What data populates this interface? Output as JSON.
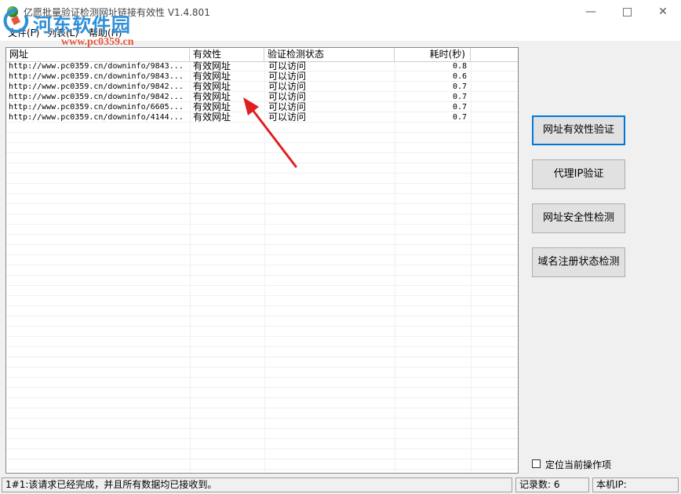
{
  "window": {
    "title": "亿愿批量验证检测网址链接有效性 V1.4.801",
    "minimize": "—",
    "close": "✕"
  },
  "watermark": {
    "title": "河东软件园",
    "url": "www.pc0359.cn"
  },
  "menu": [
    {
      "label": "文件(F)"
    },
    {
      "label": "列表(L)"
    },
    {
      "label": "帮助(H)"
    }
  ],
  "table": {
    "columns": [
      "网址",
      "有效性",
      "验证检测状态",
      "耗时(秒)"
    ],
    "rows": [
      {
        "url": "http://www.pc0359.cn/downinfo/9843...",
        "validity": "有效网址",
        "status": "可以访问",
        "time": "0.8"
      },
      {
        "url": "http://www.pc0359.cn/downinfo/9843...",
        "validity": "有效网址",
        "status": "可以访问",
        "time": "0.6"
      },
      {
        "url": "http://www.pc0359.cn/downinfo/9842...",
        "validity": "有效网址",
        "status": "可以访问",
        "time": "0.7"
      },
      {
        "url": "http://www.pc0359.cn/downinfo/9842...",
        "validity": "有效网址",
        "status": "可以访问",
        "time": "0.7"
      },
      {
        "url": "http://www.pc0359.cn/downinfo/6605...",
        "validity": "有效网址",
        "status": "可以访问",
        "time": "0.7"
      },
      {
        "url": "http://www.pc0359.cn/downinfo/4144...",
        "validity": "有效网址",
        "status": "可以访问",
        "time": "0.7"
      }
    ]
  },
  "buttons": {
    "url_validity": "网址有效性验证",
    "proxy_ip": "代理IP验证",
    "url_security": "网址安全性检测",
    "domain_registration": "域名注册状态检测"
  },
  "checkbox": {
    "label": "定位当前操作项",
    "checked": false
  },
  "statusbar": {
    "message": "1#1:该请求已经完成，并且所有数据均已接收到。",
    "record_count": "记录数: 6",
    "local_ip": "本机IP:"
  },
  "colors": {
    "accent": "#0078d7",
    "arrow": "#e02020",
    "watermark_title": "#2f8fd8",
    "watermark_url": "#e5553b"
  }
}
